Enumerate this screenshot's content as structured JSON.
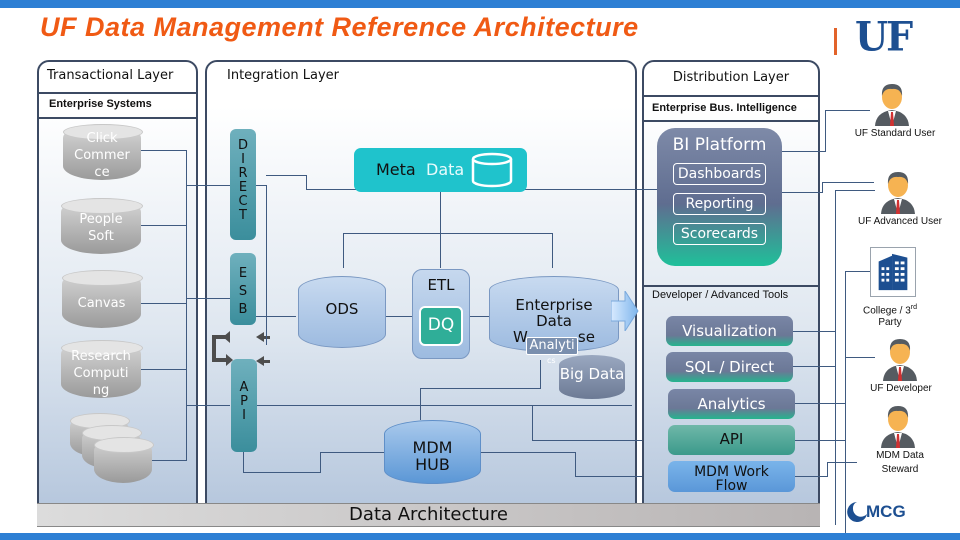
{
  "title": "UF Data Management Reference Architecture",
  "logo": "UF",
  "layers": {
    "transactional": {
      "title": "Transactional Layer",
      "subtitle": "Enterprise Systems",
      "systems": [
        "Click Commer ce",
        "People Soft",
        "Canvas",
        "Research Computi ng"
      ]
    },
    "integration": {
      "title": "Integration Layer",
      "channels": [
        "D I R E C T",
        "E S B",
        "A P I"
      ],
      "metadata": {
        "word1": "Meta",
        "word2": "Data"
      },
      "ods": "ODS",
      "etl": "ETL",
      "dq": "DQ",
      "edw": {
        "line1": "Enterprise",
        "line2": "Data",
        "line3a": "W",
        "line3b": "se"
      },
      "analytics_overlay": "Analyti",
      "analytics_overlay_tail": "cs",
      "big_data": "Big Data",
      "mdm_hub": {
        "line1": "MDM",
        "line2": "HUB"
      }
    },
    "distribution": {
      "title": "Distribution Layer",
      "subtitle": "Enterprise Bus. Intelligence",
      "bi_platform": {
        "title": "BI Platform",
        "items": [
          "Dashboards",
          "Reporting",
          "Scorecards"
        ]
      },
      "dev_tools_heading": "Developer / Advanced  Tools",
      "tools": [
        "Visualization",
        "SQL / Direct",
        "Analytics"
      ],
      "api": "API",
      "mdm_workflow": {
        "line1": "MDM Work",
        "line2": "Flow"
      }
    }
  },
  "footer": "Data Architecture",
  "users": [
    {
      "label": "UF Standard User",
      "icon": "person-icon"
    },
    {
      "label": "UF Advanced User",
      "icon": "person-icon"
    },
    {
      "label_main": "College / 3",
      "label_sup": "rd",
      "label_line2": "Party",
      "icon": "building-icon"
    },
    {
      "label": "UF Developer",
      "icon": "person-icon"
    },
    {
      "label_line1": "MDM Data",
      "label_line2": "Steward",
      "icon": "person-icon"
    }
  ],
  "partner_logo": "MCG",
  "colors": {
    "title": "#f05a14",
    "uf_blue": "#1d4f91",
    "bar_blue": "#2d7fd4",
    "metadata_cyan": "#1fc3cc",
    "dq_green": "#2fae98"
  }
}
